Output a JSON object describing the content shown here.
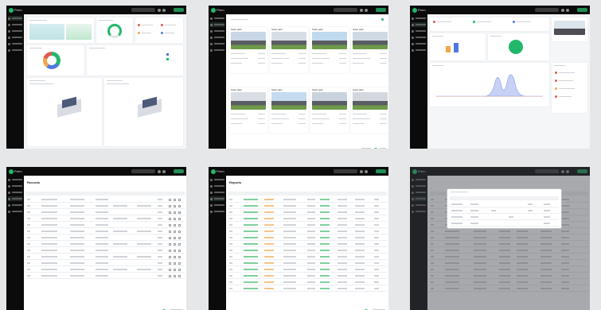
{
  "brand": {
    "logo_text": "Prem"
  },
  "colors": {
    "page_bg": "#e6e7e9",
    "sidebar": "#0b0b0b",
    "accent_green": "#22b86b",
    "blue_chart": "#a9b8f2",
    "gray_sky": "#c9d5e2",
    "grass": "#6f9a4a",
    "roof": "#4d4f55",
    "danger": "#e05a4f",
    "warning": "#f0a64b",
    "info": "#4f79e0"
  },
  "screens": {
    "projects": {
      "title": "Projects",
      "cards": [
        {
          "label": "Solar park"
        },
        {
          "label": "Solar park"
        },
        {
          "label": "Solar park"
        },
        {
          "label": "Solar park"
        },
        {
          "label": "Solar park"
        },
        {
          "label": "Solar park"
        },
        {
          "label": "Solar park"
        },
        {
          "label": "Solar park"
        }
      ]
    },
    "table_a": {
      "title": "Records"
    },
    "table_b": {
      "title": "Reports"
    },
    "modal": {
      "title": "Settings"
    }
  },
  "icons": [
    "dashboard-icon",
    "projects-icon",
    "settings-icon",
    "search-icon",
    "bell-icon",
    "user-avatar-icon"
  ]
}
